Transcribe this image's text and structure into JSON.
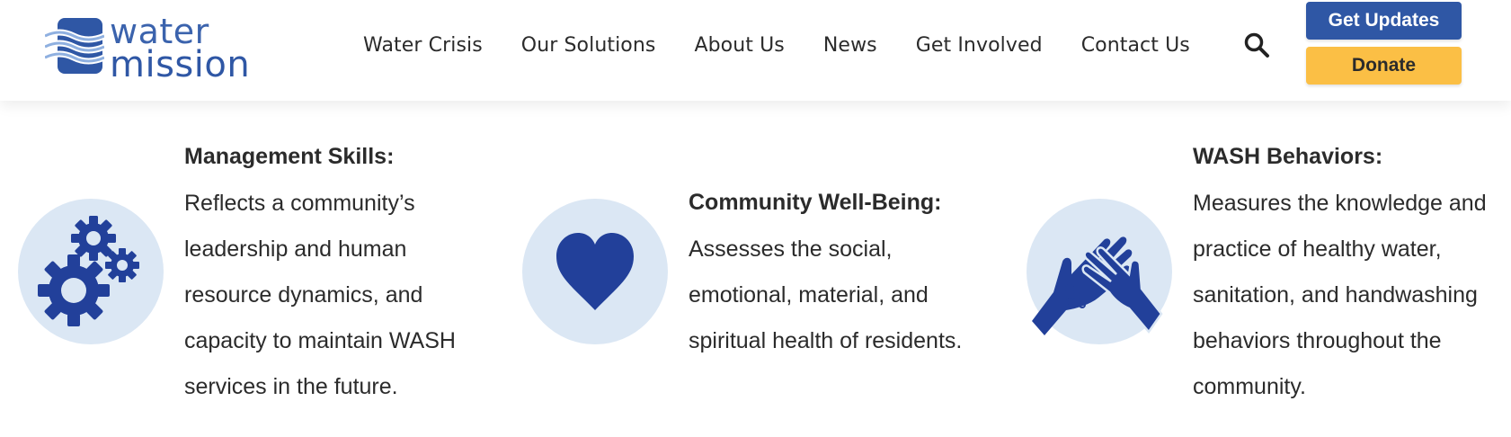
{
  "header": {
    "logo": {
      "line1": "water",
      "line2": "mission",
      "icon": "water-waves-logo-icon"
    },
    "nav": [
      {
        "label": "Water Crisis"
      },
      {
        "label": "Our Solutions"
      },
      {
        "label": "About Us"
      },
      {
        "label": "News"
      },
      {
        "label": "Get Involved"
      },
      {
        "label": "Contact Us"
      }
    ],
    "search_icon": "search-icon",
    "get_updates_label": "Get Updates",
    "donate_label": "Donate"
  },
  "features": [
    {
      "icon": "gears-icon",
      "title": "Management Skills:",
      "desc": "Reflects a community’s leadership and human resource dynamics, and capacity to maintain WASH services in the future."
    },
    {
      "icon": "heart-icon",
      "title": "Community Well-Being:",
      "desc": "Assesses the social, emotional, material, and spiritual health of residents."
    },
    {
      "icon": "handwashing-icon",
      "title": "WASH Behaviors:",
      "desc": "Measures the knowledge and practice of healthy water, sanitation, and handwashing behaviors throughout the community."
    }
  ],
  "colors": {
    "brand_blue": "#2f57a5",
    "icon_blue": "#22409a",
    "circle_bg": "#dbe7f4",
    "donate_yellow": "#fbbf45"
  }
}
